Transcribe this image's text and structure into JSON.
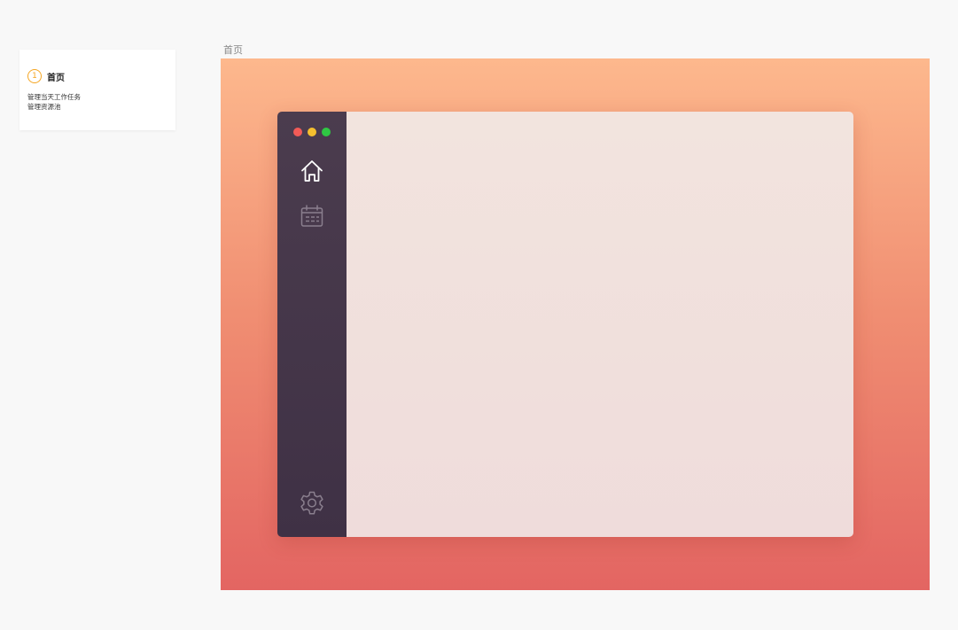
{
  "note_card": {
    "step_number": "1",
    "title": "首页",
    "lines": [
      "管理当天工作任务",
      "管理资源池"
    ]
  },
  "frame": {
    "label": "首页"
  },
  "window": {
    "traffic_lights": [
      "close",
      "minimize",
      "maximize"
    ],
    "sidebar_nav": [
      {
        "icon": "home-icon",
        "active": true
      },
      {
        "icon": "calendar-icon",
        "active": false
      }
    ],
    "sidebar_footer_icon": "gear-icon"
  },
  "colors": {
    "background_top": "#fdb88d",
    "background_bottom": "#e36562",
    "sidebar": "#43354a",
    "accent_badge": "#f5a623",
    "traffic_red": "#f25b57",
    "traffic_yellow": "#f5bf2f",
    "traffic_green": "#2fc843"
  }
}
